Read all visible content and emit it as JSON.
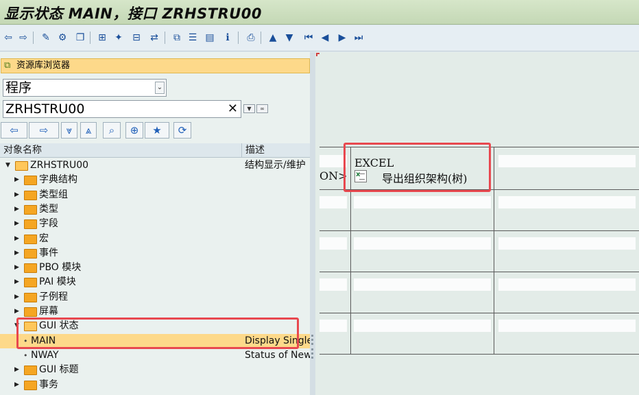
{
  "window": {
    "title": "显示状态 MAIN，接口 ZRHSTRU00"
  },
  "toolbar": {
    "buttons": [
      {
        "name": "back-arrow-icon",
        "glyph": "⇦"
      },
      {
        "name": "forward-arrow-icon",
        "glyph": "⇨"
      },
      {
        "name": "display-change-icon",
        "glyph": "✎"
      },
      {
        "name": "active-inactive-icon",
        "glyph": "⚙"
      },
      {
        "name": "other-object-icon",
        "glyph": "❐"
      },
      {
        "name": "object-list-icon",
        "glyph": "⊞"
      },
      {
        "name": "activate-icon",
        "glyph": "✦"
      },
      {
        "name": "test-icon",
        "glyph": "⊟"
      },
      {
        "name": "where-used-icon",
        "glyph": "⇄"
      },
      {
        "name": "hierarchy-icon",
        "glyph": "⧉"
      },
      {
        "name": "pretty-print-icon",
        "glyph": "☰"
      },
      {
        "name": "display-object-icon",
        "glyph": "▤"
      },
      {
        "name": "info-icon",
        "glyph": "ℹ"
      },
      {
        "name": "print-icon",
        "glyph": "⎙"
      },
      {
        "name": "scroll-up-icon",
        "glyph": "▲"
      },
      {
        "name": "scroll-down-icon",
        "glyph": "▼"
      },
      {
        "name": "first-page-icon",
        "glyph": "⏮"
      },
      {
        "name": "previous-page-icon",
        "glyph": "◀"
      },
      {
        "name": "next-page-icon",
        "glyph": "▶"
      },
      {
        "name": "last-page-icon",
        "glyph": "⏭"
      }
    ]
  },
  "repository": {
    "header": "资源库浏览器",
    "object_type": "程序",
    "object_name": "ZRHSTRU00",
    "clear_glyph": "✕",
    "nav_buttons": [
      {
        "name": "nav-back-icon",
        "glyph": "⇦"
      },
      {
        "name": "nav-forward-icon",
        "glyph": "⇨"
      },
      {
        "name": "expand-all-icon",
        "glyph": "⩔"
      },
      {
        "name": "collapse-all-icon",
        "glyph": "⩓"
      },
      {
        "name": "find-icon",
        "glyph": "⌕"
      },
      {
        "name": "new-object-icon",
        "glyph": "⊕"
      },
      {
        "name": "favorites-icon",
        "glyph": "★"
      },
      {
        "name": "refresh-icon",
        "glyph": "⟳"
      }
    ],
    "columns": {
      "name": "对象名称",
      "desc": "描述"
    },
    "tree": [
      {
        "label": "ZRHSTRU00",
        "desc": "结构显示/维护",
        "level": 0,
        "type": "folder-open",
        "arrow": "▼"
      },
      {
        "label": "字典结构",
        "desc": "",
        "level": 1,
        "type": "folder",
        "arrow": "▶"
      },
      {
        "label": "类型组",
        "desc": "",
        "level": 1,
        "type": "folder",
        "arrow": "▶"
      },
      {
        "label": "类型",
        "desc": "",
        "level": 1,
        "type": "folder",
        "arrow": "▶"
      },
      {
        "label": "字段",
        "desc": "",
        "level": 1,
        "type": "folder",
        "arrow": "▶"
      },
      {
        "label": "宏",
        "desc": "",
        "level": 1,
        "type": "folder",
        "arrow": "▶"
      },
      {
        "label": "事件",
        "desc": "",
        "level": 1,
        "type": "folder",
        "arrow": "▶"
      },
      {
        "label": "PBO 模块",
        "desc": "",
        "level": 1,
        "type": "folder",
        "arrow": "▶"
      },
      {
        "label": "PAI 模块",
        "desc": "",
        "level": 1,
        "type": "folder",
        "arrow": "▶"
      },
      {
        "label": "子例程",
        "desc": "",
        "level": 1,
        "type": "folder",
        "arrow": "▶"
      },
      {
        "label": "屏幕",
        "desc": "",
        "level": 1,
        "type": "folder",
        "arrow": "▶"
      },
      {
        "label": "GUI 状态",
        "desc": "",
        "level": 1,
        "type": "folder-open",
        "arrow": "▼"
      },
      {
        "label": "MAIN",
        "desc": "Display Single",
        "level": 2,
        "type": "leaf",
        "arrow": ""
      },
      {
        "label": "NWAY",
        "desc": "Status of New",
        "level": 2,
        "type": "leaf",
        "arrow": ""
      },
      {
        "label": "GUI 标题",
        "desc": "",
        "level": 1,
        "type": "folder",
        "arrow": "▶"
      },
      {
        "label": "事务",
        "desc": "",
        "level": 1,
        "type": "folder",
        "arrow": "▶"
      }
    ]
  },
  "menu_painter": {
    "cell_text_left": "ON>",
    "function_code": "EXCEL",
    "function_text": "导出组织架构(树)"
  },
  "colors": {
    "selection": "#fdd98a",
    "highlight_box": "#e8484f",
    "title_bg": "#c9dcbb"
  }
}
